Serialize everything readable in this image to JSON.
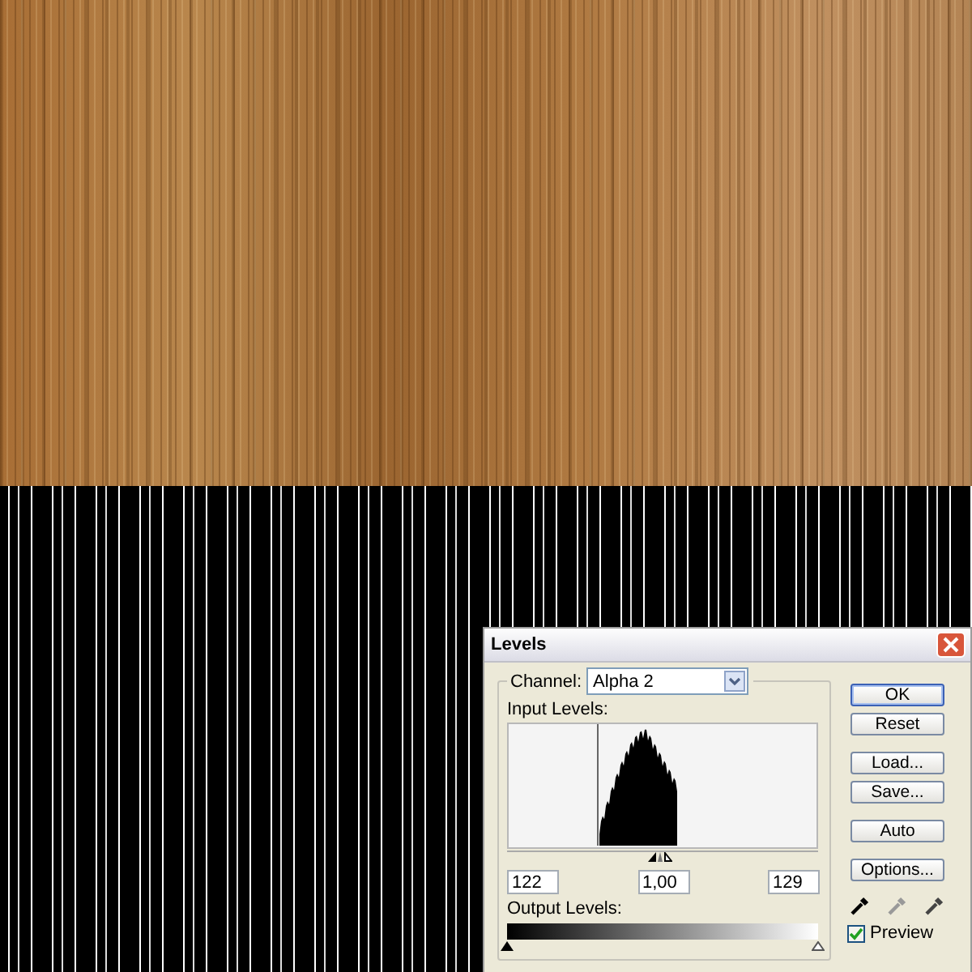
{
  "dialog": {
    "title": "Levels",
    "channel": {
      "label": "Channel:",
      "value": "Alpha 2"
    },
    "input_levels": {
      "label": "Input Levels:",
      "black": {
        "value": "122",
        "level": 0.478
      },
      "gamma": {
        "value": "1,00",
        "level": 0.49
      },
      "white": {
        "value": "129",
        "level": 0.506
      }
    },
    "output_levels": {
      "label": "Output Levels:",
      "black": {
        "level": 0
      },
      "white": {
        "level": 1
      }
    },
    "buttons": [
      {
        "label": "OK",
        "default": true
      },
      {
        "label": "Reset",
        "default": false
      },
      {
        "label": "Load...",
        "default": false
      },
      {
        "label": "Save...",
        "default": false
      },
      {
        "label": "Auto",
        "default": false
      },
      {
        "label": "Options...",
        "default": false
      }
    ],
    "preview": {
      "label": "Preview",
      "checked": true
    }
  }
}
